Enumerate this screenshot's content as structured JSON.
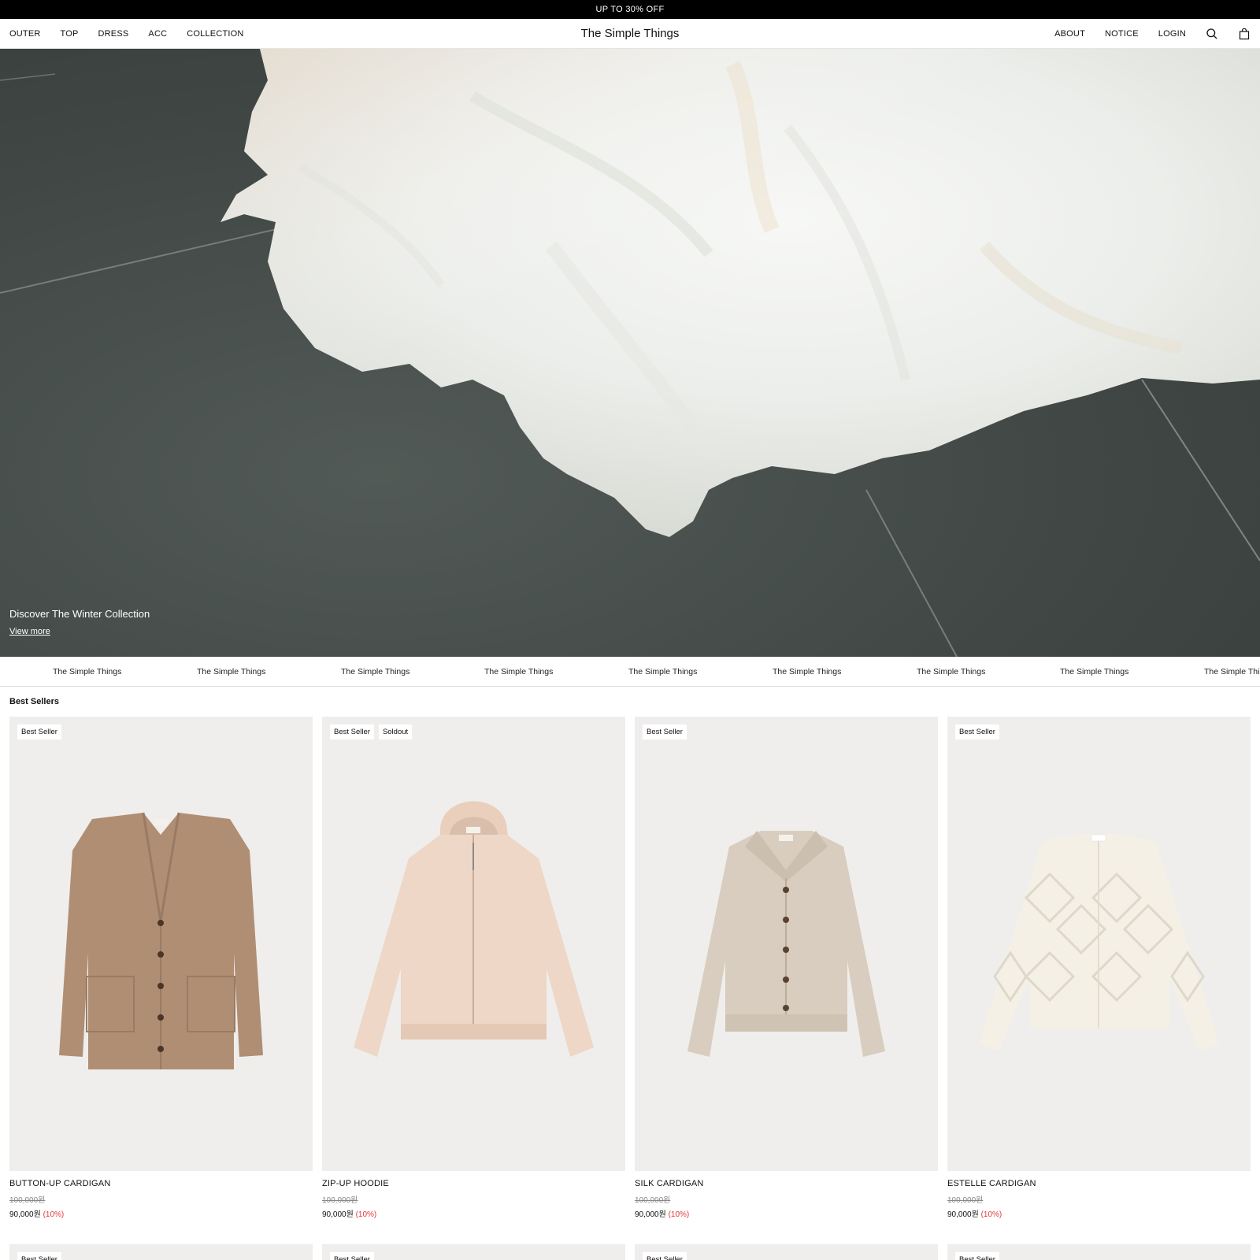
{
  "topbar": {
    "promo": "UP TO 30% OFF"
  },
  "nav": {
    "left": [
      "OUTER",
      "TOP",
      "DRESS",
      "ACC",
      "COLLECTION"
    ],
    "brand": "The Simple Things",
    "right": [
      "ABOUT",
      "NOTICE",
      "LOGIN"
    ],
    "icons": [
      "search-icon",
      "shopping-bag-icon"
    ]
  },
  "hero": {
    "title": "Discover The Winter Collection",
    "link": "View more"
  },
  "marquee": {
    "items": [
      "The Simple Things",
      "The Simple Things",
      "The Simple Things",
      "The Simple Things",
      "The Simple Things",
      "The Simple Things",
      "The Simple Things",
      "The Simple Things",
      "The Simple Things"
    ]
  },
  "best_sellers": {
    "title": "Best Sellers",
    "products": [
      {
        "badges": [
          "Best Seller"
        ],
        "name": "BUTTON-UP CARDIGAN",
        "original_price": "100,000원",
        "price": "90,000원",
        "discount": "(10%)",
        "color": "#b08e74"
      },
      {
        "badges": [
          "Best Seller",
          "Soldout"
        ],
        "name": "ZIP-UP HOODIE",
        "original_price": "100,000원",
        "price": "90,000원",
        "discount": "(10%)",
        "color": "#eed7c6"
      },
      {
        "badges": [
          "Best Seller"
        ],
        "name": "SILK CARDIGAN",
        "original_price": "100,000원",
        "price": "90,000원",
        "discount": "(10%)",
        "color": "#d8cdbf"
      },
      {
        "badges": [
          "Best Seller"
        ],
        "name": "ESTELLE CARDIGAN",
        "original_price": "100,000원",
        "price": "90,000원",
        "discount": "(10%)",
        "color": "#f4f0e6"
      }
    ],
    "next_row_badges": [
      "Best Seller",
      "Best Seller",
      "Best Seller",
      "Best Seller"
    ]
  }
}
